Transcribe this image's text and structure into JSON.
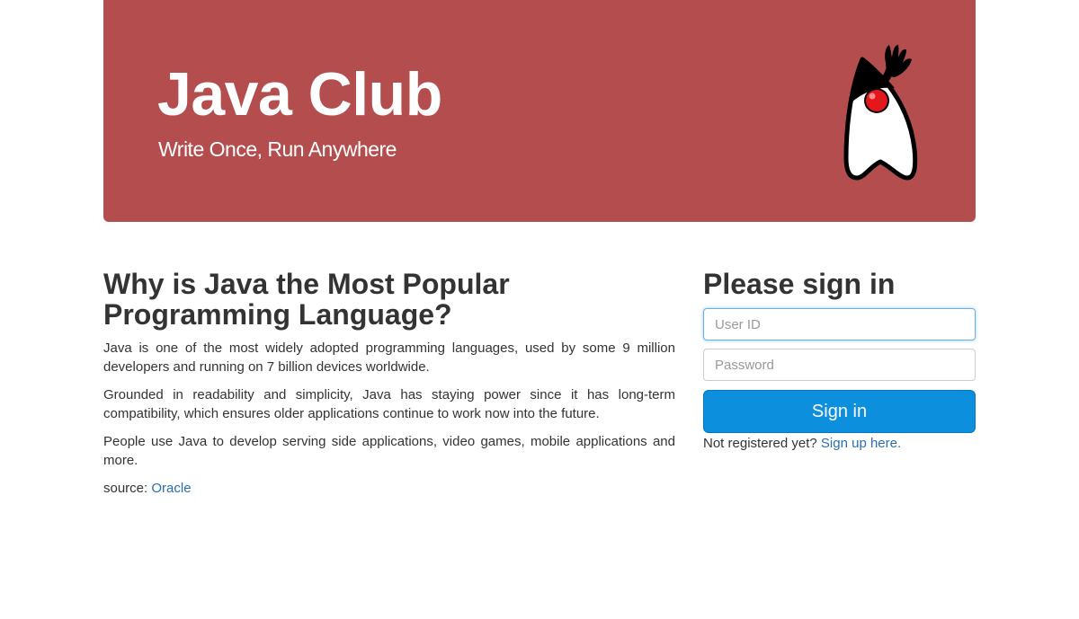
{
  "jumbotron": {
    "title": "Java Club",
    "tagline": "Write Once, Run Anywhere",
    "background_color": "#b44e4e",
    "mascot_icon": "duke-java-mascot-icon"
  },
  "article": {
    "heading": "Why is Java the Most Popular Programming Language?",
    "paragraphs": [
      "Java is one of the most widely adopted programming languages, used by some 9 million developers and running on 7 billion devices worldwide.",
      "Grounded in readability and simplicity, Java has staying power since it has long-term compatibility, which ensures older applications continue to work now into the future.",
      "People use Java to develop serving side applications, video games, mobile applications and more."
    ],
    "source_label": "source:",
    "source_link": "Oracle"
  },
  "signin": {
    "heading": "Please sign in",
    "user_id_placeholder": "User ID",
    "user_id_value": "",
    "password_placeholder": "Password",
    "password_value": "",
    "button_label": "Sign in",
    "button_color": "#0c8fdc",
    "register_prompt": "Not registered yet?",
    "register_link": "Sign up here."
  }
}
